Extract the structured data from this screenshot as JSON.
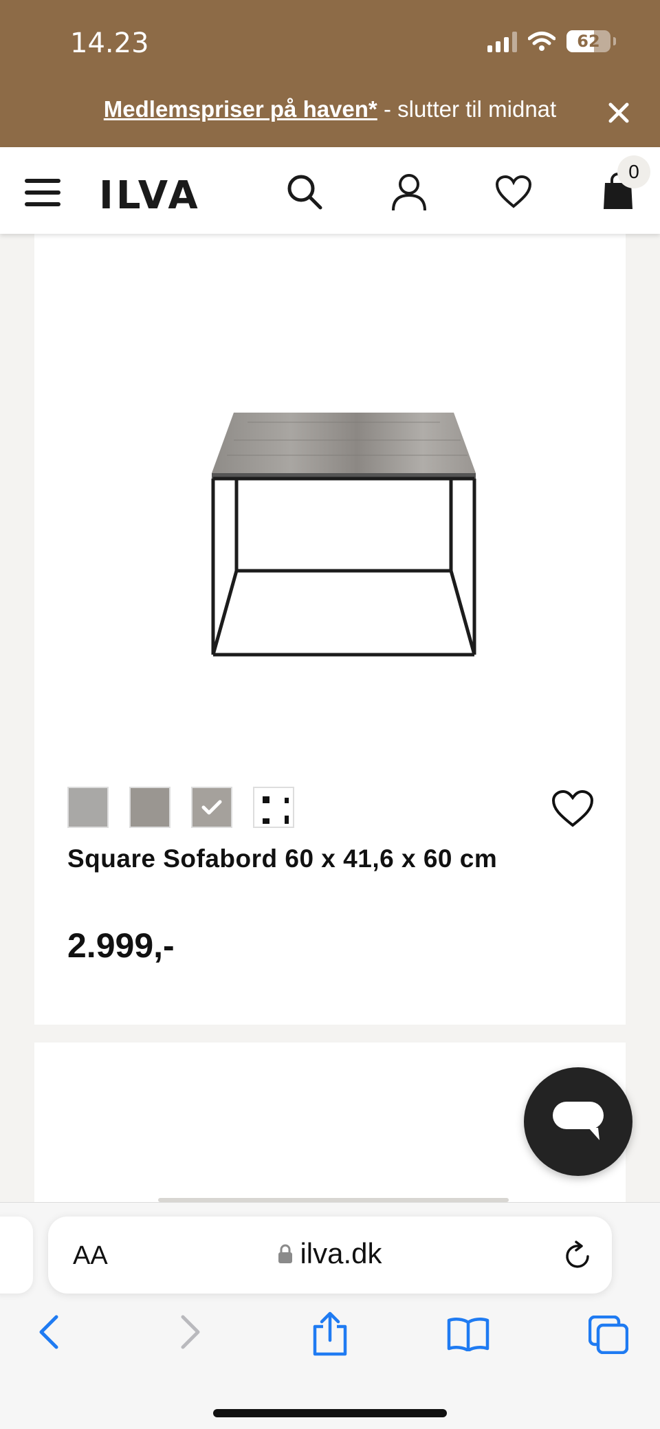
{
  "status_bar": {
    "time": "14.23",
    "battery": "62",
    "icons": [
      "signal-icon",
      "wifi-icon",
      "battery-icon"
    ]
  },
  "promo": {
    "link_text": "Medlemspriser på haven*",
    "rest_text": " - slutter til midnat",
    "close_icon": "close-icon"
  },
  "header": {
    "logo": "ILVA",
    "cart_count": "0",
    "icons": [
      "menu-icon",
      "search-icon",
      "account-icon",
      "heart-icon",
      "bag-icon"
    ]
  },
  "product": {
    "name": "Square Sofabord 60 x 41,6 x 60 cm",
    "price": "2.999,-",
    "swatches": [
      {
        "color": "#a9a8a6",
        "selected": false
      },
      {
        "color": "#9a9691",
        "selected": false
      },
      {
        "color": "#a5a19c",
        "selected": true
      },
      {
        "color": "#ffffff",
        "selected": false
      }
    ]
  },
  "safari": {
    "aa_label": "AA",
    "url": "ilva.dk"
  },
  "colors": {
    "brand_brown": "#8d6b47",
    "ios_blue": "#1f7bf2"
  }
}
